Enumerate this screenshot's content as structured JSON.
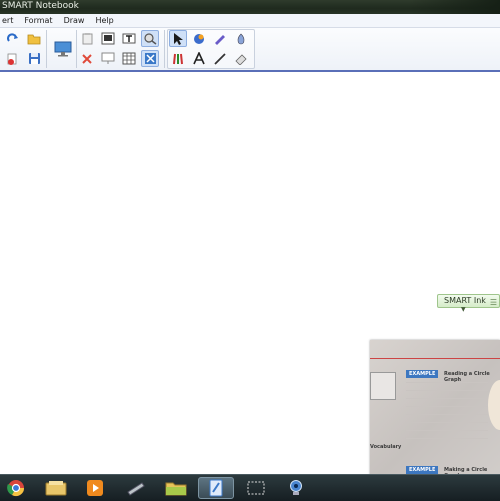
{
  "window": {
    "title": "SMART Notebook"
  },
  "menu": {
    "items": [
      "ert",
      "Format",
      "Draw",
      "Help"
    ]
  },
  "ink_widget": {
    "label": "SMART Ink"
  },
  "camera_overlay": {
    "banner_1": "EXAMPLE",
    "heading_1": "Reading a Circle Graph",
    "banner_2": "EXAMPLE",
    "heading_2": "Making a Circle Graph",
    "margin_label": "Vocabulary"
  },
  "taskbar": {
    "apps": [
      "chrome-icon",
      "library-icon",
      "media-player-icon",
      "document-icon",
      "folder-icon",
      "notebook-icon",
      "capture-icon",
      "webcam-icon"
    ]
  },
  "colors": {
    "accent": "#5a6fb8",
    "taskbar": "#1c2529",
    "ink_green": "#d5ecc8"
  }
}
